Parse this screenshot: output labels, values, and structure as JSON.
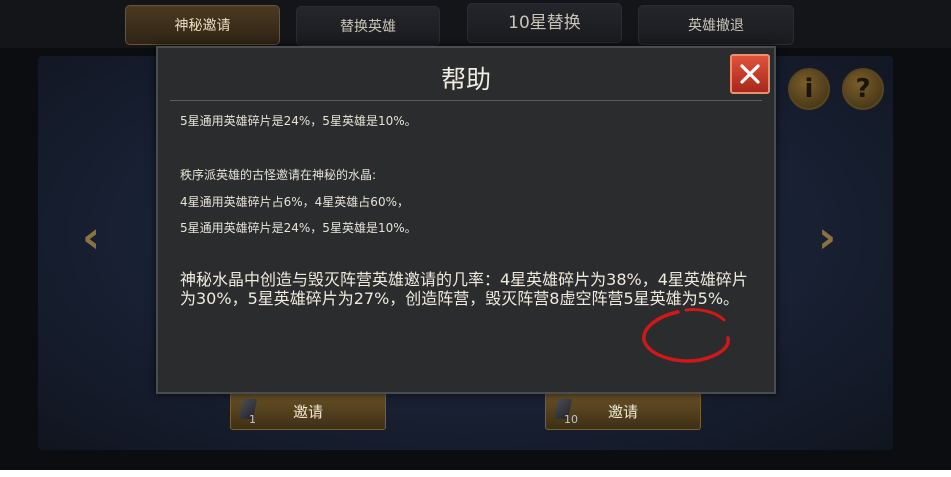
{
  "tabs": [
    {
      "label": "神秘邀请",
      "active": true
    },
    {
      "label": "替换英雄",
      "active": false
    },
    {
      "label": "10星替换",
      "active": false
    },
    {
      "label": "英雄撤退",
      "active": false
    }
  ],
  "background": {
    "left_arrow": "‹",
    "right_arrow": "›",
    "info_glyph": "i",
    "help_glyph": "?",
    "invite_buttons": [
      {
        "label": "邀请",
        "count": "1"
      },
      {
        "label": "邀请",
        "count": "10"
      }
    ]
  },
  "dialog": {
    "title": "帮助",
    "lines": [
      "5星通用英雄碎片是24%，5星英雄是10%。",
      "秩序派英雄的古怪邀请在神秘的水晶:",
      "4星通用英雄碎片占6%，4星英雄占60%，",
      "5星通用英雄碎片是24%，5星英雄是10%。"
    ],
    "paragraph": "神秘水晶中创造与毁灭阵营英雄邀请的几率：4星英雄碎片为38%，4星英雄碎片为30%，5星英雄碎片为27%，创造阵营，毁灭阵营8虚空阵营5星英雄为5%。"
  },
  "colors": {
    "close_button": "#c8382a",
    "annotation_circle": "#d01818",
    "tab_active": "#4a3a22",
    "dialog_bg": "#2b2c2e"
  },
  "icons": [
    "close-icon",
    "info-icon",
    "help-icon",
    "scroll-icon",
    "arrow-left-icon",
    "arrow-right-icon"
  ]
}
